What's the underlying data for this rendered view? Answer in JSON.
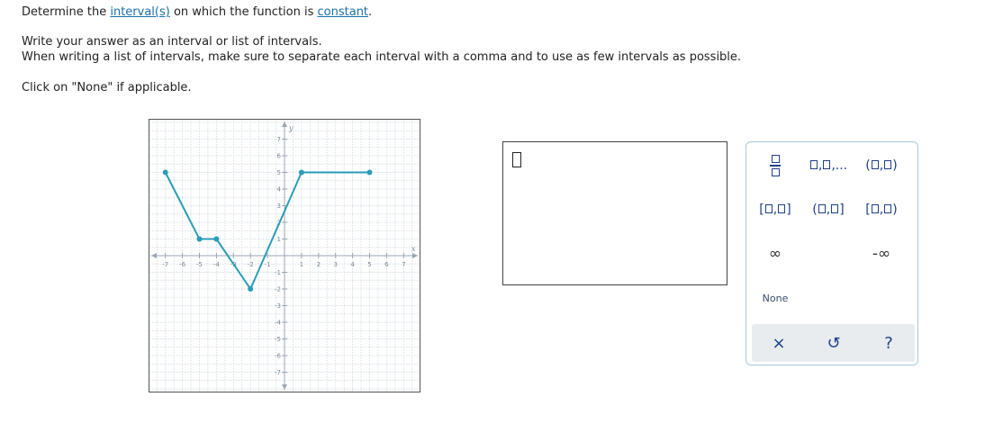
{
  "prompt": {
    "line1_pre": "Determine the ",
    "link_intervals": "interval(s)",
    "line1_mid": " on which the function is ",
    "link_constant": "constant",
    "line1_post": ".",
    "line2": "Write your answer as an interval or list of intervals.",
    "line3": "When writing a list of intervals, make sure to separate each interval with a comma and to use as few intervals as possible.",
    "line4": "Click on \"None\" if applicable."
  },
  "graph": {
    "x_axis_label": "x",
    "y_axis_label": "y",
    "x_ticks": [
      "-7",
      "-6",
      "-5",
      "-4",
      "-3",
      "-2",
      "-1",
      "1",
      "2",
      "3",
      "4",
      "5",
      "6",
      "7"
    ],
    "y_ticks": [
      "7",
      "6",
      "5",
      "4",
      "3",
      "2",
      "1",
      "-1",
      "-2",
      "-3",
      "-4",
      "-5",
      "-6",
      "-7"
    ],
    "x_range": [
      -7.5,
      7.5
    ],
    "y_range": [
      -7.5,
      7.5
    ],
    "grid": true,
    "line_color": "#2a9db8",
    "points": [
      {
        "x": -7,
        "y": 5
      },
      {
        "x": -5,
        "y": 1
      },
      {
        "x": -4,
        "y": 1
      },
      {
        "x": -2,
        "y": -2
      },
      {
        "x": 1,
        "y": 5
      },
      {
        "x": 5,
        "y": 5
      }
    ]
  },
  "answer": {
    "value": ""
  },
  "palette": {
    "infinity": "∞",
    "neg_infinity": "-∞",
    "none": "None",
    "clear_icon": "×",
    "undo_icon": "↺",
    "help_icon": "?",
    "accent_color": "#1f3f8a"
  }
}
